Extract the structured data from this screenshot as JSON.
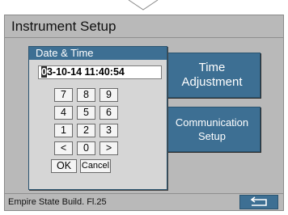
{
  "window": {
    "title": "Instrument Setup"
  },
  "buttons": {
    "time_adjustment": [
      "Time",
      "Adjustment"
    ],
    "communication_setup": [
      "Communication",
      "Setup"
    ]
  },
  "dialog": {
    "title": "Date & Time",
    "cursor_char": "0",
    "datetime_rest": "3-10-14  11:40:54",
    "keypad": {
      "row1": [
        "7",
        "8",
        "9"
      ],
      "row2": [
        "4",
        "5",
        "6"
      ],
      "row3": [
        "1",
        "2",
        "3"
      ],
      "row4": [
        "<",
        "0",
        ">"
      ]
    },
    "ok_label": "OK",
    "cancel_label": "Cancel"
  },
  "status": {
    "location": "Empire State Build. Fl.25"
  },
  "icons": {
    "back": "return-arrow-icon",
    "notch": "top-chevron-icon"
  },
  "colors": {
    "accent": "#3d6f93",
    "background": "#b9b9b9"
  }
}
